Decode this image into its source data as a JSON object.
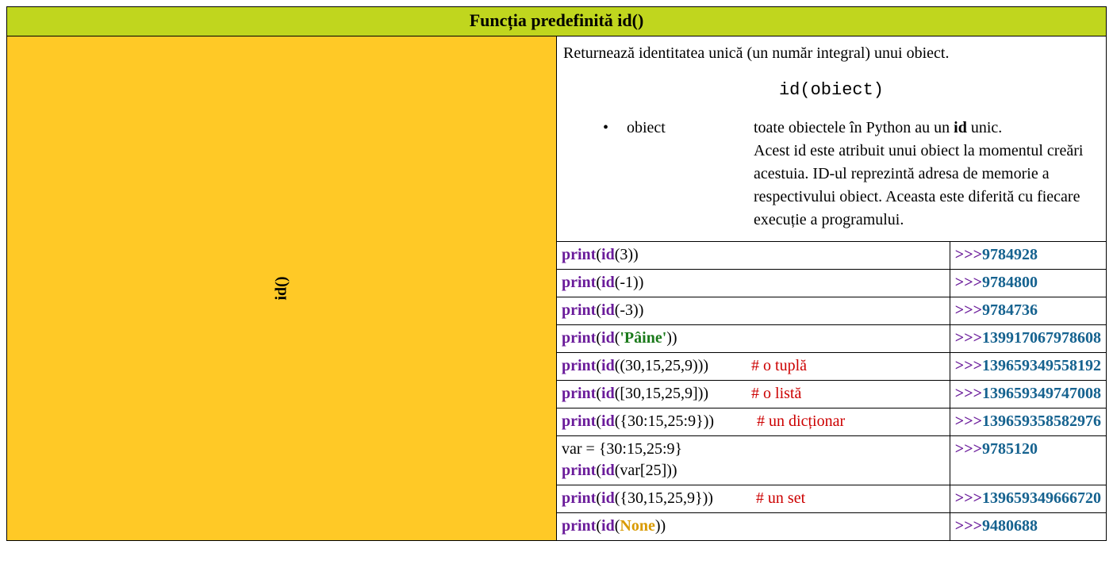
{
  "title": "Funcția predefinită id()",
  "side_label": "id()",
  "intro_line": "Returnează identitatea unică (un număr integral) unui obiect.",
  "syntax": "id(obiect)",
  "param": {
    "name": "obiect",
    "desc1_prefix": "toate obiectele în Python au un ",
    "desc1_bold": "id",
    "desc1_suffix": " unic.",
    "desc2": "Acest id este atribuit unui obiect la momentul creări acestuia. ID-ul reprezintă adresa de memorie a respectivului obiect. Aceasta este diferită cu fiecare execuție a programului."
  },
  "kw": {
    "print": "print",
    "id": "id",
    "none": "None"
  },
  "prompt": ">>>",
  "rows": [
    {
      "arg_plain": "3",
      "output": "9784928"
    },
    {
      "arg_plain": "-1",
      "output": "9784800"
    },
    {
      "arg_plain": "-3",
      "output": "9784736"
    },
    {
      "arg_string": "'Pâine'",
      "output": "139917067978608"
    },
    {
      "arg_plain": "(30,15,25,9)",
      "comment": "# o tuplă",
      "output": "139659349558192"
    },
    {
      "arg_plain": "[30,15,25,9]",
      "comment": "# o listă",
      "output": "139659349747008"
    },
    {
      "arg_plain": "{30:15,25:9}",
      "comment": "# un dicționar",
      "output": "139659358582976"
    },
    {
      "preline": "var = {30:15,25:9}",
      "arg_plain": "var[25]",
      "output": "9785120"
    },
    {
      "arg_plain": "{30,15,25,9}",
      "comment": "# un set",
      "output": "139659349666720"
    },
    {
      "arg_none": true,
      "output": "9480688"
    }
  ]
}
